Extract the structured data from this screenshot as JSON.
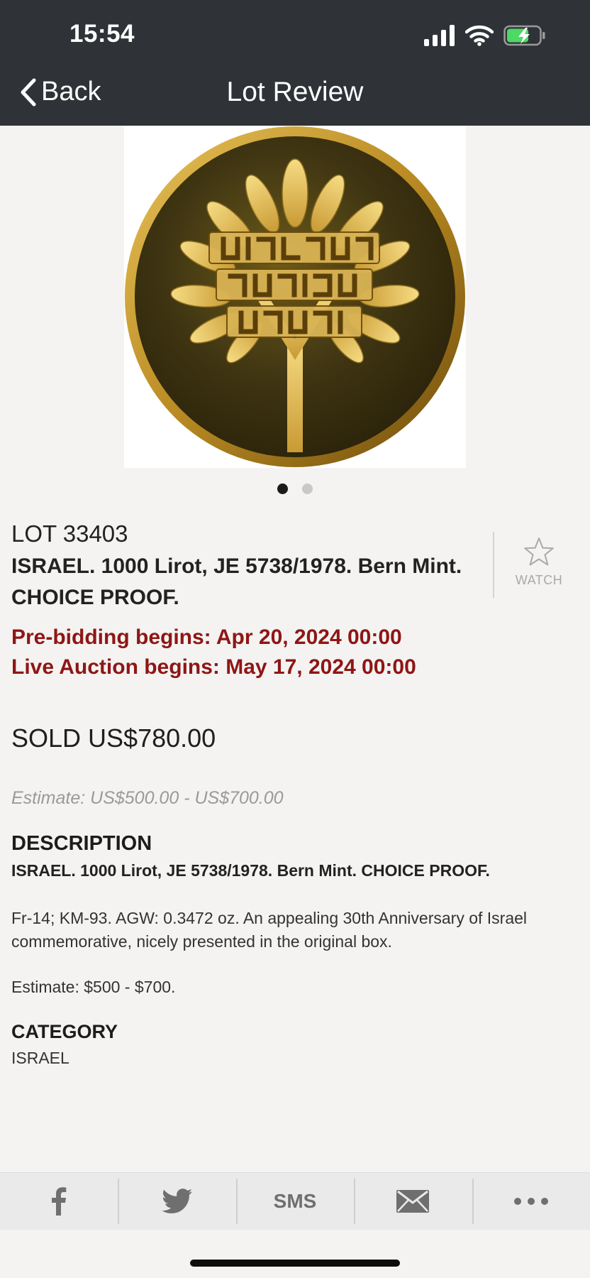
{
  "status_bar": {
    "time": "15:54"
  },
  "nav": {
    "back_label": "Back",
    "title": "Lot Review"
  },
  "gallery": {
    "image_count": 2,
    "active_index": 0
  },
  "lot": {
    "number": "LOT 33403",
    "title": "ISRAEL. 1000 Lirot, JE 5738/1978. Bern Mint. CHOICE PROOF.",
    "watch_label": "WATCH",
    "pre_bidding": "Pre-bidding begins: Apr 20, 2024 00:00",
    "live_auction": "Live Auction begins: May 17, 2024 00:00",
    "sold": "SOLD US$780.00",
    "estimate": "Estimate: US$500.00 - US$700.00"
  },
  "description": {
    "heading": "DESCRIPTION",
    "bold_line": "ISRAEL. 1000 Lirot, JE 5738/1978. Bern Mint. CHOICE PROOF.",
    "paragraph": "Fr-14; KM-93. AGW: 0.3472 oz. An appealing 30th Anniversary of Israel commemorative, nicely presented in the original box.",
    "estimate_line": "Estimate: $500 - $700."
  },
  "category": {
    "heading": "CATEGORY",
    "value": "ISRAEL"
  },
  "share": {
    "sms_label": "SMS",
    "icons": [
      "facebook-icon",
      "twitter-icon",
      "sms-button",
      "mail-icon",
      "more-icon"
    ]
  },
  "colors": {
    "header_bg": "#2f3337",
    "accent_red": "#8e1616",
    "battery_green": "#4cd964",
    "page_bg": "#f4f3f1"
  }
}
